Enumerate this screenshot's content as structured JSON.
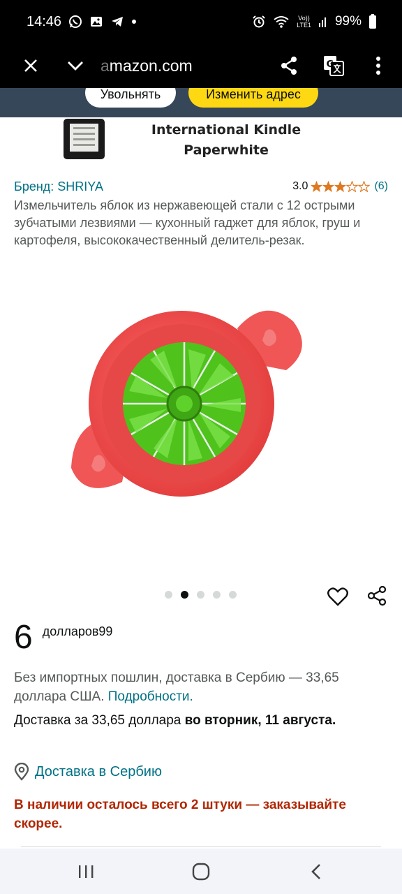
{
  "status_bar": {
    "time": "14:46",
    "battery": "99%",
    "left_icons": [
      "whatsapp-icon",
      "image-icon",
      "telegram-icon",
      "dot-icon"
    ],
    "right_icons": [
      "alarm-icon",
      "wifi-icon",
      "volte-icon",
      "signal-icon",
      "battery-icon"
    ],
    "volte_label_top": "Vo))",
    "volte_label_bottom": "LTE1"
  },
  "browser": {
    "url_faded": "a",
    "url": "mazon.com",
    "icons": [
      "close-icon",
      "chevron-down-icon",
      "share-icon",
      "translate-icon",
      "more-vert-icon"
    ]
  },
  "address_prompt": {
    "dismiss_label": "Увольнять",
    "change_label": "Изменить адрес"
  },
  "banner": {
    "line1": "International Kindle",
    "line2": "Paperwhite"
  },
  "product": {
    "brand": "Бренд: SHRIYA",
    "rating": "3.0",
    "rating_stars": 3,
    "rating_count": "(6)",
    "title": "Измельчитель яблок из нержавеющей стали с 12 острыми зубчатыми лезвиями — кухонный гаджет для яблок, груш и картофеля, высококачественный делитель-резак.",
    "image_count": 5,
    "active_image": 2
  },
  "price": {
    "whole": "6",
    "suffix": "долларов99"
  },
  "shipping": {
    "import_text": "Без импортных пошлин, доставка в Сербию — 33,65 доллара США. ",
    "details_link": "Подробности.",
    "delivery_prefix": "Доставка за 33,65 доллара ",
    "delivery_date": "во вторник, 11 августа.",
    "location_link": "Доставка в  Сербию"
  },
  "stock": "В наличии осталось всего 2 штуки — заказывайте скорее.",
  "nav": {
    "icons": [
      "recent-apps-icon",
      "home-icon",
      "back-icon"
    ]
  },
  "colors": {
    "link": "#007185",
    "stock_red": "#b12704",
    "star": "#de7921",
    "address_band": "#37475a",
    "change_button": "#ffd814"
  }
}
